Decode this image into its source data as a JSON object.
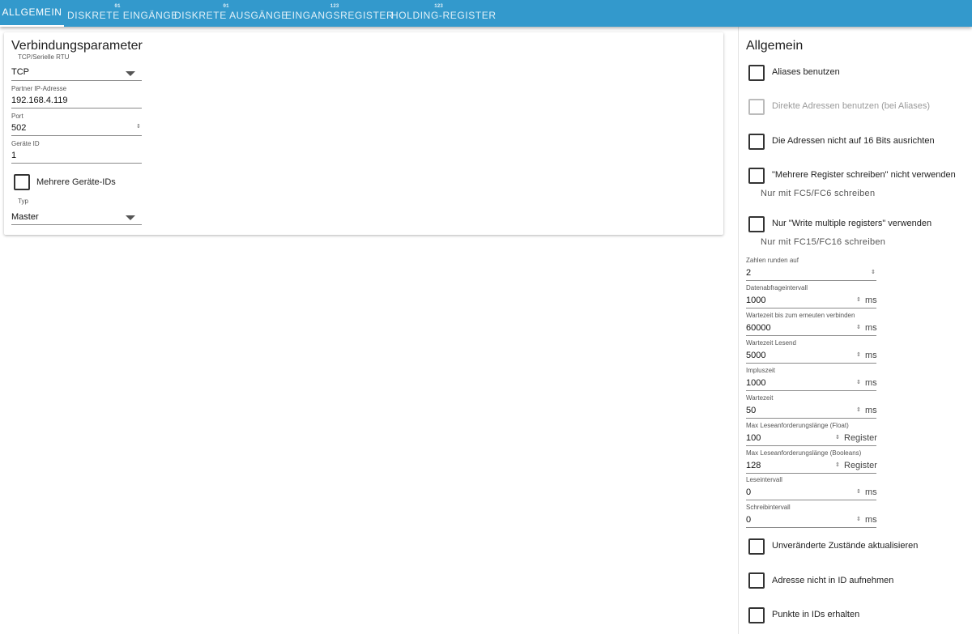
{
  "tabs": [
    {
      "label": "ALLGEMEIN",
      "icon": ""
    },
    {
      "label": "DISKRETE EINGÄNGE",
      "icon": "01"
    },
    {
      "label": "DISKRETE AUSGÄNGE",
      "icon": "01"
    },
    {
      "label": "EINGANGSREGISTER",
      "icon": "123"
    },
    {
      "label": "HOLDING-REGISTER",
      "icon": "123"
    }
  ],
  "connection": {
    "title": "Verbindungsparameter",
    "mode": {
      "label": "TCP/Serielle RTU",
      "value": "TCP"
    },
    "ip": {
      "label": "Partner IP-Adresse",
      "value": "192.168.4.119"
    },
    "port": {
      "label": "Port",
      "value": "502"
    },
    "device_id": {
      "label": "Geräte ID",
      "value": "1"
    },
    "multi_ids": {
      "label": "Mehrere Geräte-IDs",
      "checked": false
    },
    "type": {
      "label": "Typ",
      "value": "Master"
    }
  },
  "general": {
    "title": "Allgemein",
    "aliases": {
      "label": "Aliases benutzen",
      "checked": false
    },
    "direct_addresses": {
      "label": "Direkte Adressen benutzen (bei Aliases)",
      "checked": false,
      "disabled": true
    },
    "no_align": {
      "label": "Die Adressen nicht auf 16 Bits ausrichten",
      "checked": false
    },
    "no_multi_write": {
      "label": "\"Mehrere Register schreiben\" nicht verwenden",
      "checked": false,
      "helper": "Nur mit FC5/FC6 schreiben"
    },
    "only_multi_write": {
      "label": "Nur \"Write multiple registers\" verwenden",
      "checked": false,
      "helper": "Nur mit FC15/FC16 schreiben"
    },
    "round": {
      "label": "Zahlen runden auf",
      "value": "2"
    },
    "poll": {
      "label": "Datenabfrageintervall",
      "value": "1000",
      "unit": "ms"
    },
    "reconnect": {
      "label": "Wartezeit bis zum erneuten verbinden",
      "value": "60000",
      "unit": "ms"
    },
    "read_timeout": {
      "label": "Wartezeit Lesend",
      "value": "5000",
      "unit": "ms"
    },
    "pulse": {
      "label": "Impluszeit",
      "value": "1000",
      "unit": "ms"
    },
    "wait": {
      "label": "Wartezeit",
      "value": "50",
      "unit": "ms"
    },
    "max_float": {
      "label": "Max Leseanforderungslänge (Float)",
      "value": "100",
      "unit": "Register"
    },
    "max_bool": {
      "label": "Max Leseanforderungslänge (Booleans)",
      "value": "128",
      "unit": "Register"
    },
    "read_interval": {
      "label": "Leseintervall",
      "value": "0",
      "unit": "ms"
    },
    "write_interval": {
      "label": "Schreibintervall",
      "value": "0",
      "unit": "ms"
    },
    "update_unchanged": {
      "label": "Unveränderte Zustände aktualisieren",
      "checked": false
    },
    "no_address_in_id": {
      "label": "Adresse nicht in ID aufnehmen",
      "checked": false
    },
    "keep_dots": {
      "label": "Punkte in IDs erhalten",
      "checked": false
    }
  },
  "colors": {
    "tabbar": "#3399cc",
    "text": "#202020"
  }
}
